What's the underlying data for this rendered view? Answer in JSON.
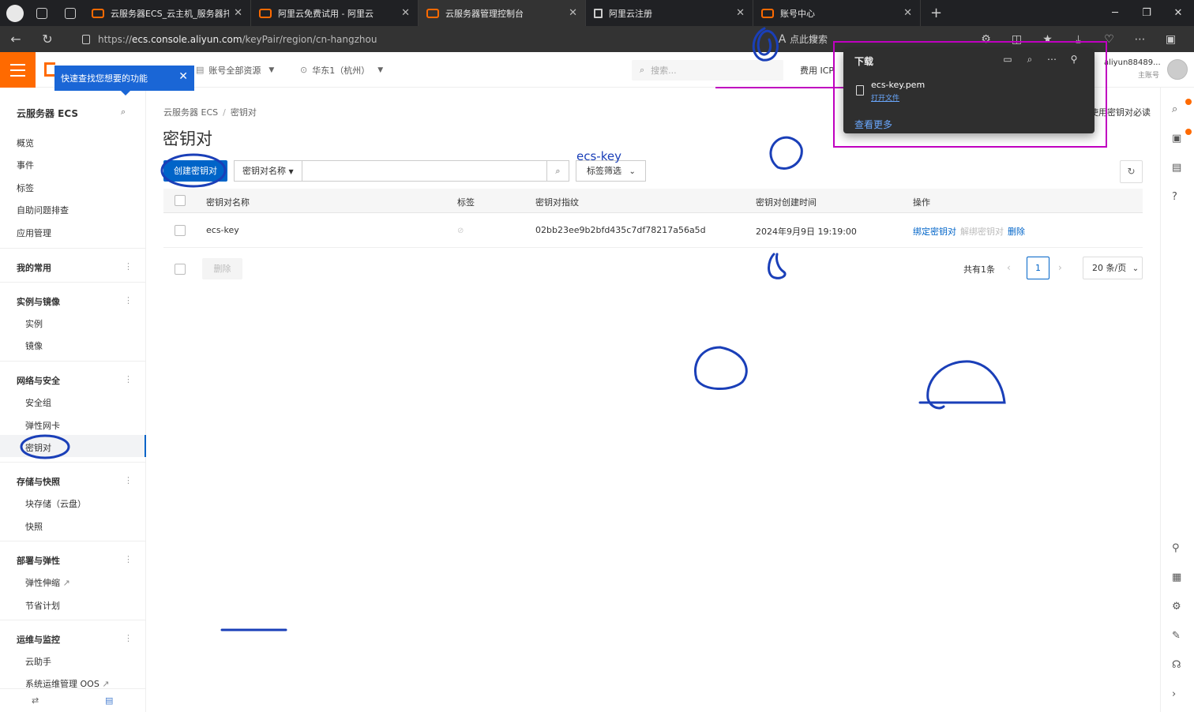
{
  "browser": {
    "tabs": [
      {
        "title": "云服务器ECS_云主机_服务器托管",
        "favicon": "aliyun-icon"
      },
      {
        "title": "阿里云免费试用 - 阿里云",
        "favicon": "aliyun-icon"
      },
      {
        "title": "云服务器管理控制台",
        "favicon": "aliyun-icon",
        "active": true
      },
      {
        "title": "阿里云注册",
        "favicon": "document-icon"
      },
      {
        "title": "账号中心",
        "favicon": "aliyun-icon"
      }
    ],
    "url_prefix": "https://",
    "url_host": "ecs.console.aliyun.com",
    "url_path": "/keyPair/region/cn-hangzhou",
    "search_hint": "点此搜索"
  },
  "header": {
    "tooltip": "快速查找您想要的功能",
    "resource_select": "账号全部资源",
    "region_select": "华东1（杭州）",
    "search_placeholder": "搜索...",
    "links": "费用  ICP",
    "user_name": "aliyun88489...",
    "user_sub": "主账号",
    "brand_color": "#ff6a00"
  },
  "sidebar": {
    "title": "云服务器 ECS",
    "items": [
      "概览",
      "事件",
      "标签",
      "自助问题排查",
      "应用管理"
    ],
    "groups": [
      {
        "name": "我的常用",
        "items": []
      },
      {
        "name": "实例与镜像",
        "items": [
          "实例",
          "镜像"
        ]
      },
      {
        "name": "网络与安全",
        "items": [
          "安全组",
          "弹性网卡",
          "密钥对"
        ]
      },
      {
        "name": "存储与快照",
        "items": [
          "块存储（云盘）",
          "快照"
        ]
      },
      {
        "name": "部署与弹性",
        "items": [
          "弹性伸缩",
          "节省计划"
        ]
      },
      {
        "name": "运维与监控",
        "items": [
          "云助手",
          "系统运维管理 OOS"
        ]
      }
    ],
    "active_item": "密钥对"
  },
  "main": {
    "breadcrumb": [
      "云服务器 ECS",
      "密钥对"
    ],
    "title": "密钥对",
    "help_link": "使用密钥对必读",
    "create_button": "创建密钥对",
    "filter_field": "密钥对名称",
    "tag_filter": "标签筛选",
    "columns": [
      "密钥对名称",
      "标签",
      "密钥对指纹",
      "密钥对创建时间",
      "操作"
    ],
    "rows": [
      {
        "name": "ecs-key",
        "fingerprint": "02bb23ee9b2bfd435c7df78217a56a5d",
        "created": "2024年9月9日 19:19:00",
        "actions": [
          "绑定密钥对",
          "解绑密钥对",
          "删除"
        ]
      }
    ],
    "bulk_delete": "删除",
    "total": "共有1条",
    "current_page": "1",
    "page_size": "20 条/页",
    "accent": "#0064c8"
  },
  "download": {
    "title": "下载",
    "file": "ecs-key.pem",
    "open": "打开文件",
    "more": "查看更多"
  },
  "annotation": {
    "text": "ecs-key",
    "pen_color": "#1a3fb8"
  }
}
